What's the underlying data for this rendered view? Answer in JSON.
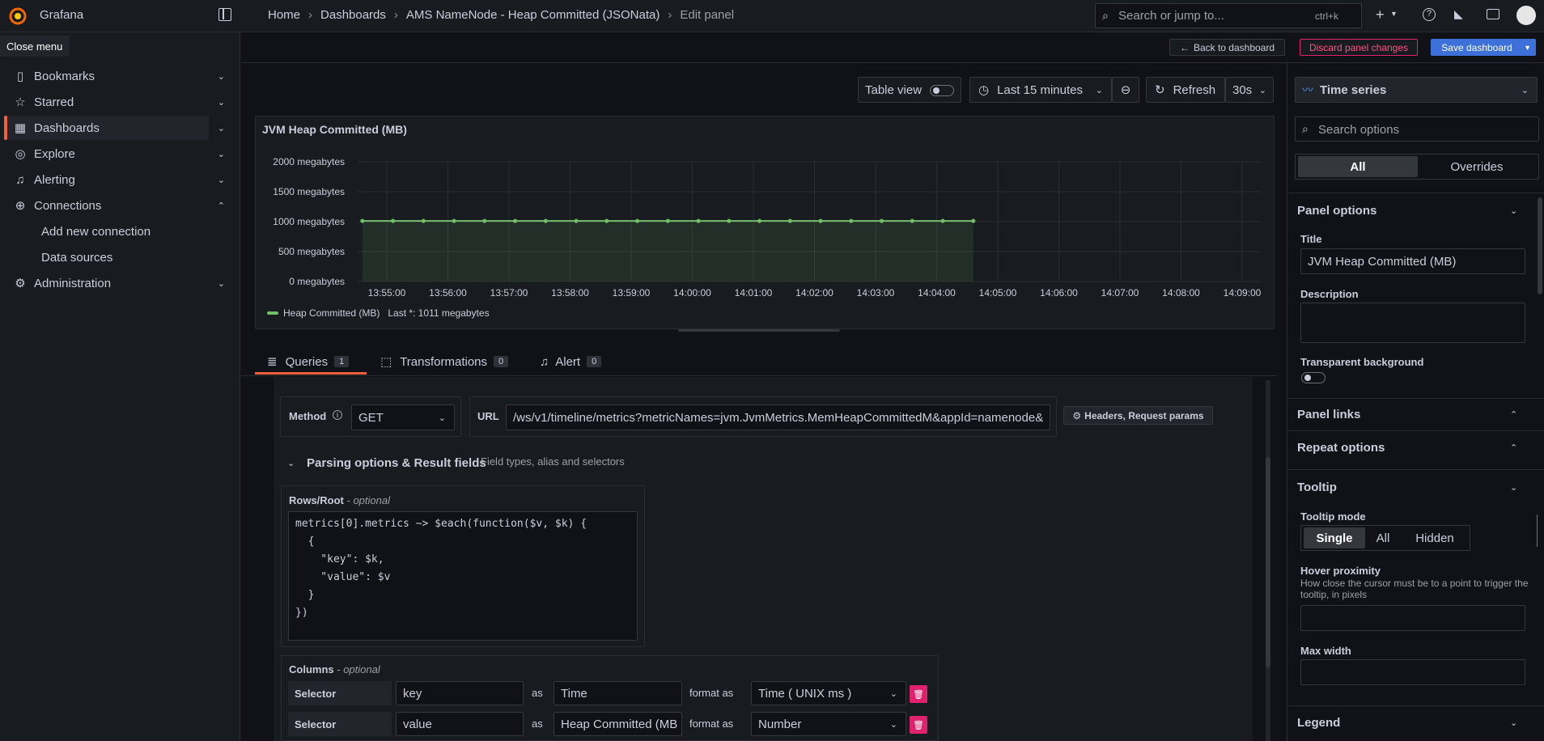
{
  "app": {
    "name": "Grafana",
    "tooltip": "Close menu"
  },
  "breadcrumb": [
    "Home",
    "Dashboards",
    "AMS NameNode - Heap Committed (JSONata)",
    "Edit panel"
  ],
  "search": {
    "placeholder": "Search or jump to...",
    "shortcut": "ctrl+k"
  },
  "sidebar": {
    "items": [
      {
        "label": "Bookmarks"
      },
      {
        "label": "Starred"
      },
      {
        "label": "Dashboards"
      },
      {
        "label": "Explore"
      },
      {
        "label": "Alerting"
      },
      {
        "label": "Connections"
      },
      {
        "label": "Administration"
      }
    ],
    "sub_items": [
      "Add new connection",
      "Data sources"
    ]
  },
  "actions": {
    "back": "Back to dashboard",
    "discard": "Discard panel changes",
    "save": "Save dashboard"
  },
  "toolbar": {
    "table_view": "Table view",
    "time_range": "Last 15 minutes",
    "refresh": "Refresh",
    "interval": "30s"
  },
  "chart_data": {
    "type": "line",
    "title": "JVM Heap Committed (MB)",
    "x": [
      "13:55:00",
      "13:56:00",
      "13:57:00",
      "13:58:00",
      "13:59:00",
      "14:00:00",
      "14:01:00",
      "14:02:00",
      "14:03:00",
      "14:04:00",
      "14:05:00",
      "14:06:00",
      "14:07:00",
      "14:08:00",
      "14:09:00"
    ],
    "y_ticks": [
      "2000 megabytes",
      "1500 megabytes",
      "1000 megabytes",
      "500 megabytes",
      "0 megabytes"
    ],
    "ylim": [
      0,
      2000
    ],
    "series": [
      {
        "name": "Heap Committed (MB)",
        "points_minutes": [
          0,
          0.5,
          1,
          1.5,
          2,
          2.5,
          3,
          3.5,
          4,
          4.5,
          5,
          5.5,
          6,
          6.5,
          7,
          7.5,
          8,
          8.5,
          9,
          9.5,
          10
        ],
        "value": 1011,
        "color": "#73bf69"
      }
    ],
    "legend": {
      "text": "Heap Committed (MB)",
      "stat": "Last *: 1011 megabytes",
      "placement": "bottom-left"
    },
    "grid": true
  },
  "tabs": [
    {
      "label": "Queries",
      "count": "1"
    },
    {
      "label": "Transformations",
      "count": "0"
    },
    {
      "label": "Alert",
      "count": "0"
    }
  ],
  "query": {
    "method_label": "Method",
    "method_value": "GET",
    "url_label": "URL",
    "url_value": "/ws/v1/timeline/metrics?metricNames=jvm.JvmMetrics.MemHeapCommittedM&appId=namenode&",
    "headers_button": "Headers, Request params",
    "parsing_title": "Parsing options & Result fields",
    "parsing_desc": "Field types, alias and selectors",
    "rows_label": "Rows/Root",
    "optional": "- optional",
    "rows_code": "metrics[0].metrics ~> $each(function($v, $k) {\n  {\n    \"key\": $k,\n    \"value\": $v\n  }\n})",
    "columns_label": "Columns",
    "columns": [
      {
        "selector": "Selector",
        "key": "key",
        "as": "as",
        "alias": "Time",
        "format_label": "format as",
        "format": "Time ( UNIX ms )"
      },
      {
        "selector": "Selector",
        "key": "value",
        "as": "as",
        "alias": "Heap Committed (MB",
        "format_label": "format as",
        "format": "Number"
      }
    ]
  },
  "options": {
    "viz": "Time series",
    "search_placeholder": "Search options",
    "tab_all": "All",
    "tab_overrides": "Overrides",
    "panel_options": "Panel options",
    "title_label": "Title",
    "title_value": "JVM Heap Committed (MB)",
    "description_label": "Description",
    "transparent_label": "Transparent background",
    "panel_links": "Panel links",
    "repeat_options": "Repeat options",
    "tooltip": "Tooltip",
    "tooltip_mode": "Tooltip mode",
    "modes": [
      "Single",
      "All",
      "Hidden"
    ],
    "hover_proximity": "Hover proximity",
    "hover_desc": "How close the cursor must be to a point to trigger the tooltip, in pixels",
    "max_width": "Max width",
    "legend": "Legend"
  }
}
